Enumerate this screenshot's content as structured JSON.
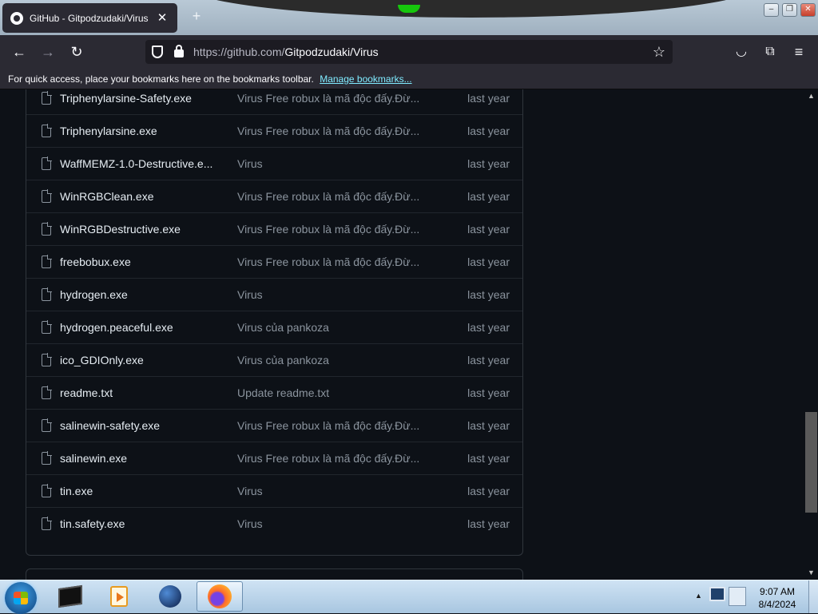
{
  "browser": {
    "tab_title": "GitHub - Gitpodzudaki/Virus",
    "tab_close": "✕",
    "new_tab": "+",
    "url_host": "https://github.com/",
    "url_path": "Gitpodzudaki/Virus",
    "bookmarks_text": "For quick access, place your bookmarks here on the bookmarks toolbar.",
    "bookmarks_link": "Manage bookmarks...",
    "icons": {
      "back": "arrow-left-icon",
      "forward": "arrow-right-icon",
      "reload": "reload-icon",
      "shield": "shield-icon",
      "lock": "lock-icon",
      "star": "star-icon",
      "pocket": "pocket-icon",
      "extensions": "puzzle-icon",
      "menu": "hamburger-menu-icon"
    }
  },
  "files": [
    {
      "name": "Triphenylarsine-Safety.exe",
      "message": "Virus Free robux là mã độc đấy.Đừ...",
      "date": "last year"
    },
    {
      "name": "Triphenylarsine.exe",
      "message": "Virus Free robux là mã độc đấy.Đừ...",
      "date": "last year"
    },
    {
      "name": "WaffMEMZ-1.0-Destructive.e...",
      "message": "Virus",
      "date": "last year"
    },
    {
      "name": "WinRGBClean.exe",
      "message": "Virus Free robux là mã độc đấy.Đừ...",
      "date": "last year"
    },
    {
      "name": "WinRGBDestructive.exe",
      "message": "Virus Free robux là mã độc đấy.Đừ...",
      "date": "last year"
    },
    {
      "name": "freebobux.exe",
      "message": "Virus Free robux là mã độc đấy.Đừ...",
      "date": "last year"
    },
    {
      "name": "hydrogen.exe",
      "message": "Virus",
      "date": "last year"
    },
    {
      "name": "hydrogen.peaceful.exe",
      "message": "Virus của pankoza",
      "date": "last year"
    },
    {
      "name": "ico_GDIOnly.exe",
      "message": "Virus của pankoza",
      "date": "last year"
    },
    {
      "name": "readme.txt",
      "message": "Update readme.txt",
      "date": "last year"
    },
    {
      "name": "salinewin-safety.exe",
      "message": "Virus Free robux là mã độc đấy.Đừ...",
      "date": "last year"
    },
    {
      "name": "salinewin.exe",
      "message": "Virus Free robux là mã độc đấy.Đừ...",
      "date": "last year"
    },
    {
      "name": "tin.exe",
      "message": "Virus",
      "date": "last year"
    },
    {
      "name": "tin.safety.exe",
      "message": "Virus",
      "date": "last year"
    }
  ],
  "taskbar": {
    "apps": [
      "cmd-icon",
      "media-player-icon",
      "globe-icon",
      "firefox-icon"
    ],
    "clock_time": "9:07 AM",
    "clock_date": "8/4/2024"
  },
  "colors": {
    "page_bg": "#0d1117",
    "border": "#30363d",
    "text_primary": "#e6edf3",
    "text_muted": "#8b949e",
    "browser_chrome": "#2b2a33",
    "link": "#80ebff"
  }
}
